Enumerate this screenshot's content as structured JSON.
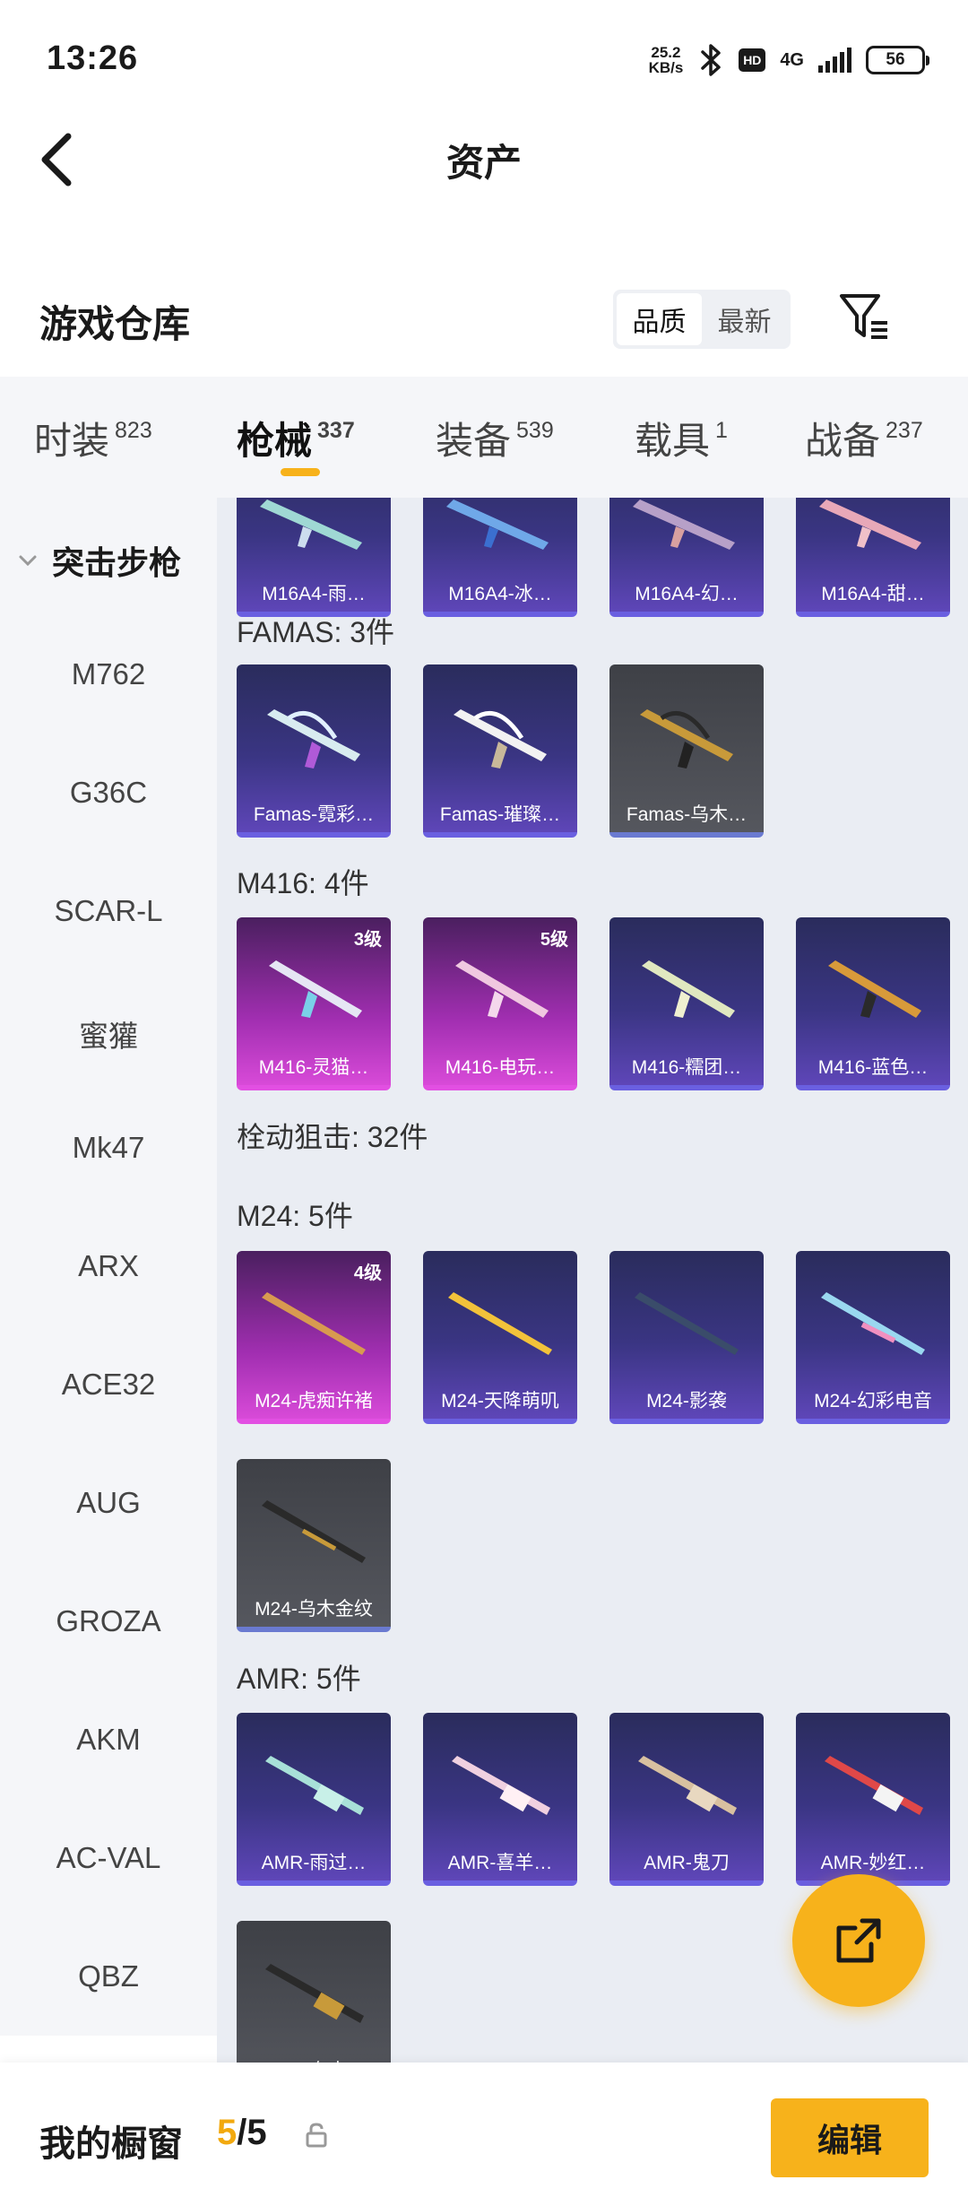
{
  "status_bar": {
    "time": "13:26",
    "net_speed_value": "25.2",
    "net_speed_unit": "KB/s",
    "hd": "HD",
    "network": "4G",
    "battery": "56"
  },
  "header": {
    "title": "资产"
  },
  "warehouse": {
    "title": "游戏仓库",
    "sort": [
      "品质",
      "最新"
    ],
    "sort_active": "品质"
  },
  "tabs": [
    {
      "label": "时装",
      "count": "823"
    },
    {
      "label": "枪械",
      "count": "337"
    },
    {
      "label": "装备",
      "count": "539"
    },
    {
      "label": "载具",
      "count": "1"
    },
    {
      "label": "战备",
      "count": "237"
    }
  ],
  "sidebar": {
    "group": "突击步枪",
    "items": [
      "M762",
      "G36C",
      "SCAR-L",
      "蜜獾",
      "Mk47",
      "ARX",
      "ACE32",
      "AUG",
      "GROZA",
      "AKM",
      "AC-VAL",
      "QBZ"
    ]
  },
  "groups": {
    "m16_cards": [
      "M16A4-雨…",
      "M16A4-冰…",
      "M16A4-幻…",
      "M16A4-甜…"
    ],
    "famas_label": "FAMAS: 3件",
    "famas_cards": [
      "Famas-霓彩…",
      "Famas-璀璨…",
      "Famas-乌木…"
    ],
    "m416_label": "M416: 4件",
    "m416_cards": [
      "M416-灵猫…",
      "M416-电玩…",
      "M416-糯团…",
      "M416-蓝色…"
    ],
    "m416_levels": [
      "3级",
      "5级"
    ],
    "sniper_label": "栓动狙击: 32件",
    "m24_label": "M24: 5件",
    "m24_cards": [
      "M24-虎痴许褚",
      "M24-天降萌叽",
      "M24-影袭",
      "M24-幻彩电音",
      "M24-乌木金纹"
    ],
    "m24_levels": [
      "4级"
    ],
    "amr_label": "AMR: 5件",
    "amr_cards": [
      "AMR-雨过…",
      "AMR-喜羊…",
      "AMR-鬼刀",
      "AMR-妙红…",
      "AMR-乌木…"
    ]
  },
  "bottom": {
    "showcase_label": "我的橱窗",
    "current": "5",
    "total": "/5",
    "edit": "编辑"
  },
  "colors": {
    "accent": "#f7b21b",
    "purple_card": "#3a3583",
    "pink_card": "#a02eb0",
    "gray_card": "#55575e"
  }
}
